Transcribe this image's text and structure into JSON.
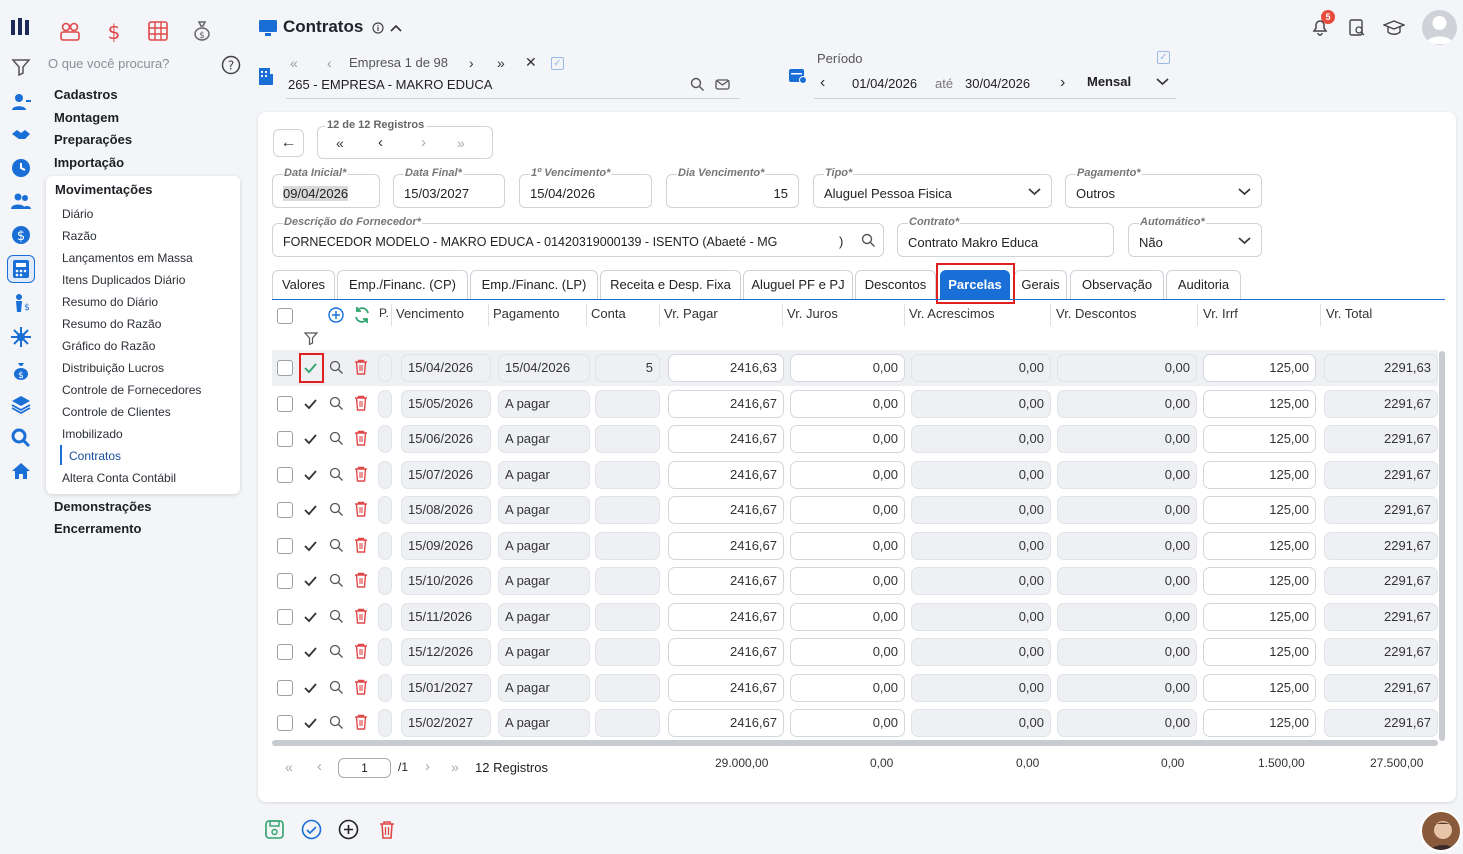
{
  "search_placeholder": "O que você procura?",
  "notification_count": "5",
  "menu": {
    "cadastros": "Cadastros",
    "montagem": "Montagem",
    "preparacoes": "Preparações",
    "importacao": "Importação",
    "demonstracoes": "Demonstrações",
    "encerramento": "Encerramento"
  },
  "submenu": {
    "title": "Movimentações",
    "items": [
      "Diário",
      "Razão",
      "Lançamentos em Massa",
      "Itens Duplicados Diário",
      "Resumo do Diário",
      "Resumo do Razão",
      "Gráfico do Razão",
      "Distribuição Lucros",
      "Controle de Fornecedores",
      "Controle de Clientes",
      "Imobilizado",
      "Contratos",
      "Altera Conta Contábil"
    ]
  },
  "page_title": "Contratos",
  "empresa": {
    "nav": "Empresa 1 de 98",
    "value": "265 - EMPRESA - MAKRO EDUCA"
  },
  "periodo": {
    "label": "Período",
    "start": "01/04/2026",
    "ate": "até",
    "end": "30/04/2026",
    "freq": "Mensal"
  },
  "registros_nav": "12 de 12 Registros",
  "form": {
    "data_inicial": {
      "label": "Data Inicial*",
      "value": "09/04/2026"
    },
    "data_final": {
      "label": "Data Final*",
      "value": "15/03/2027"
    },
    "primeiro_venc": {
      "label": "1º Vencimento*",
      "value": "15/04/2026"
    },
    "dia_venc": {
      "label": "Dia Vencimento*",
      "value": "15"
    },
    "tipo": {
      "label": "Tipo*",
      "value": "Aluguel Pessoa Fisica"
    },
    "pagamento": {
      "label": "Pagamento*",
      "value": "Outros"
    },
    "fornecedor": {
      "label": "Descrição do Fornecedor*",
      "value": "FORNECEDOR MODELO - MAKRO EDUCA - 01420319000139 - ISENTO (Abaeté - MG",
      "paren": ")"
    },
    "contrato": {
      "label": "Contrato*",
      "value": "Contrato Makro Educa"
    },
    "automatico": {
      "label": "Automático*",
      "value": "Não"
    }
  },
  "tabs": [
    "Valores",
    "Emp./Financ. (CP)",
    "Emp./Financ. (LP)",
    "Receita e Desp. Fixa",
    "Aluguel PF e PJ",
    "Descontos",
    "Parcelas",
    "Gerais",
    "Observação",
    "Auditoria"
  ],
  "columns": [
    "P.",
    "Vencimento",
    "Pagamento",
    "Conta",
    "Vr. Pagar",
    "Vr. Juros",
    "Vr. Acrescimos",
    "Vr. Descontos",
    "Vr. Irrf",
    "Vr. Total"
  ],
  "rows": [
    {
      "venc": "15/04/2026",
      "pag": "15/04/2026",
      "conta": "5",
      "pagar": "2416,63",
      "juros": "0,00",
      "acresc": "0,00",
      "desc": "0,00",
      "irrf": "125,00",
      "total": "2291,63"
    },
    {
      "venc": "15/05/2026",
      "pag": "A pagar",
      "conta": "",
      "pagar": "2416,67",
      "juros": "0,00",
      "acresc": "0,00",
      "desc": "0,00",
      "irrf": "125,00",
      "total": "2291,67"
    },
    {
      "venc": "15/06/2026",
      "pag": "A pagar",
      "conta": "",
      "pagar": "2416,67",
      "juros": "0,00",
      "acresc": "0,00",
      "desc": "0,00",
      "irrf": "125,00",
      "total": "2291,67"
    },
    {
      "venc": "15/07/2026",
      "pag": "A pagar",
      "conta": "",
      "pagar": "2416,67",
      "juros": "0,00",
      "acresc": "0,00",
      "desc": "0,00",
      "irrf": "125,00",
      "total": "2291,67"
    },
    {
      "venc": "15/08/2026",
      "pag": "A pagar",
      "conta": "",
      "pagar": "2416,67",
      "juros": "0,00",
      "acresc": "0,00",
      "desc": "0,00",
      "irrf": "125,00",
      "total": "2291,67"
    },
    {
      "venc": "15/09/2026",
      "pag": "A pagar",
      "conta": "",
      "pagar": "2416,67",
      "juros": "0,00",
      "acresc": "0,00",
      "desc": "0,00",
      "irrf": "125,00",
      "total": "2291,67"
    },
    {
      "venc": "15/10/2026",
      "pag": "A pagar",
      "conta": "",
      "pagar": "2416,67",
      "juros": "0,00",
      "acresc": "0,00",
      "desc": "0,00",
      "irrf": "125,00",
      "total": "2291,67"
    },
    {
      "venc": "15/11/2026",
      "pag": "A pagar",
      "conta": "",
      "pagar": "2416,67",
      "juros": "0,00",
      "acresc": "0,00",
      "desc": "0,00",
      "irrf": "125,00",
      "total": "2291,67"
    },
    {
      "venc": "15/12/2026",
      "pag": "A pagar",
      "conta": "",
      "pagar": "2416,67",
      "juros": "0,00",
      "acresc": "0,00",
      "desc": "0,00",
      "irrf": "125,00",
      "total": "2291,67"
    },
    {
      "venc": "15/01/2027",
      "pag": "A pagar",
      "conta": "",
      "pagar": "2416,67",
      "juros": "0,00",
      "acresc": "0,00",
      "desc": "0,00",
      "irrf": "125,00",
      "total": "2291,67"
    },
    {
      "venc": "15/02/2027",
      "pag": "A pagar",
      "conta": "",
      "pagar": "2416,67",
      "juros": "0,00",
      "acresc": "0,00",
      "desc": "0,00",
      "irrf": "125,00",
      "total": "2291,67"
    }
  ],
  "pager": {
    "page": "1",
    "total": "/1",
    "count": "12 Registros"
  },
  "totals": {
    "pagar": "29.000,00",
    "juros": "0,00",
    "acresc": "0,00",
    "desc": "0,00",
    "irrf": "1.500,00",
    "total": "27.500,00"
  },
  "colors": {
    "accent": "#1a6fd6",
    "highlight": "#e02020",
    "danger": "#e04848",
    "success": "#2ea36b"
  }
}
